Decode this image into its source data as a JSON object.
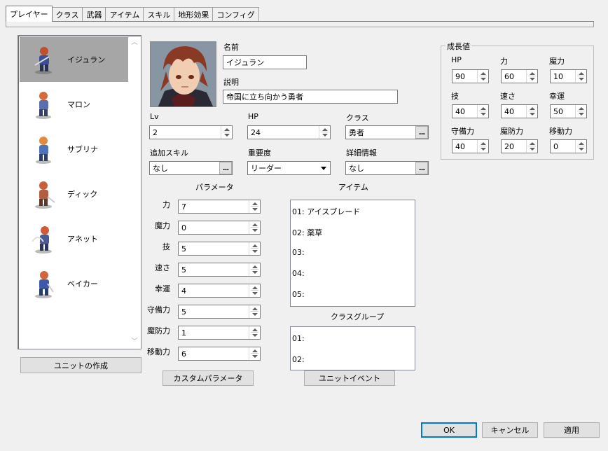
{
  "tabs": [
    "プレイヤー",
    "クラス",
    "武器",
    "アイテム",
    "スキル",
    "地形効果",
    "コンフィグ"
  ],
  "units": [
    {
      "name": "イジュラン",
      "selected": true
    },
    {
      "name": "マロン"
    },
    {
      "name": "サブリナ"
    },
    {
      "name": "ディック"
    },
    {
      "name": "アネット"
    },
    {
      "name": "ベイカー"
    }
  ],
  "buttons": {
    "create_unit": "ユニットの作成",
    "custom_params": "カスタムパラメータ",
    "unit_event": "ユニットイベント",
    "ok": "OK",
    "cancel": "キャンセル",
    "apply": "適用"
  },
  "profile": {
    "name_label": "名前",
    "name_value": "イジュラン",
    "desc_label": "説明",
    "desc_value": "帝国に立ち向かう勇者",
    "lv_label": "Lv",
    "lv_value": "2",
    "hp_label": "HP",
    "hp_value": "24",
    "class_label": "クラス",
    "class_value": "勇者",
    "skill_label": "追加スキル",
    "skill_value": "なし",
    "importance_label": "重要度",
    "importance_value": "リーダー",
    "detail_label": "詳細情報",
    "detail_value": "なし"
  },
  "params": {
    "title": "パラメータ",
    "rows": [
      {
        "label": "力",
        "value": "7"
      },
      {
        "label": "魔力",
        "value": "0"
      },
      {
        "label": "技",
        "value": "5"
      },
      {
        "label": "速さ",
        "value": "5"
      },
      {
        "label": "幸運",
        "value": "4"
      },
      {
        "label": "守備力",
        "value": "5"
      },
      {
        "label": "魔防力",
        "value": "1"
      },
      {
        "label": "移動力",
        "value": "6"
      }
    ]
  },
  "items": {
    "title": "アイテム",
    "rows": [
      "01:  アイスブレード",
      "02:  薬草",
      "03:",
      "04:",
      "05:"
    ]
  },
  "class_group": {
    "title": "クラスグループ",
    "rows": [
      "01:",
      "02:"
    ]
  },
  "growth": {
    "title": "成長値",
    "cells": [
      {
        "label": "HP",
        "value": "90"
      },
      {
        "label": "力",
        "value": "60"
      },
      {
        "label": "魔力",
        "value": "10"
      },
      {
        "label": "技",
        "value": "40"
      },
      {
        "label": "速さ",
        "value": "40"
      },
      {
        "label": "幸運",
        "value": "50"
      },
      {
        "label": "守備力",
        "value": "40"
      },
      {
        "label": "魔防力",
        "value": "20"
      },
      {
        "label": "移動力",
        "value": "0"
      }
    ]
  }
}
